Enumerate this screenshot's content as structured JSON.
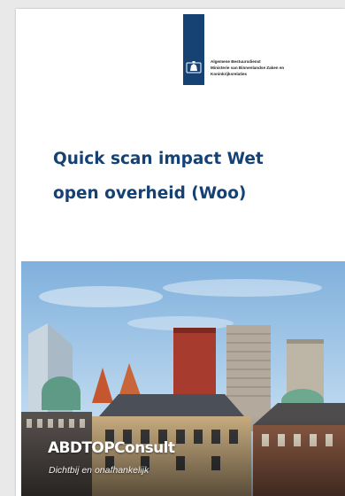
{
  "document": {
    "title_line_1": "Quick scan impact Wet",
    "title_line_2": "open overheid (Woo)"
  },
  "logo": {
    "ministry_text": "Algemene Bestuursdienst\nMinisterie van Binnenlandse Zaken en\nKoninkrijksrelaties",
    "bar_color": "#154273"
  },
  "cover_photo": {
    "brand": "ABDTOPConsult",
    "tagline": "Dichtbij en onafhankelijk"
  },
  "colors": {
    "title": "#154273",
    "sky": "#9dc3e6"
  }
}
